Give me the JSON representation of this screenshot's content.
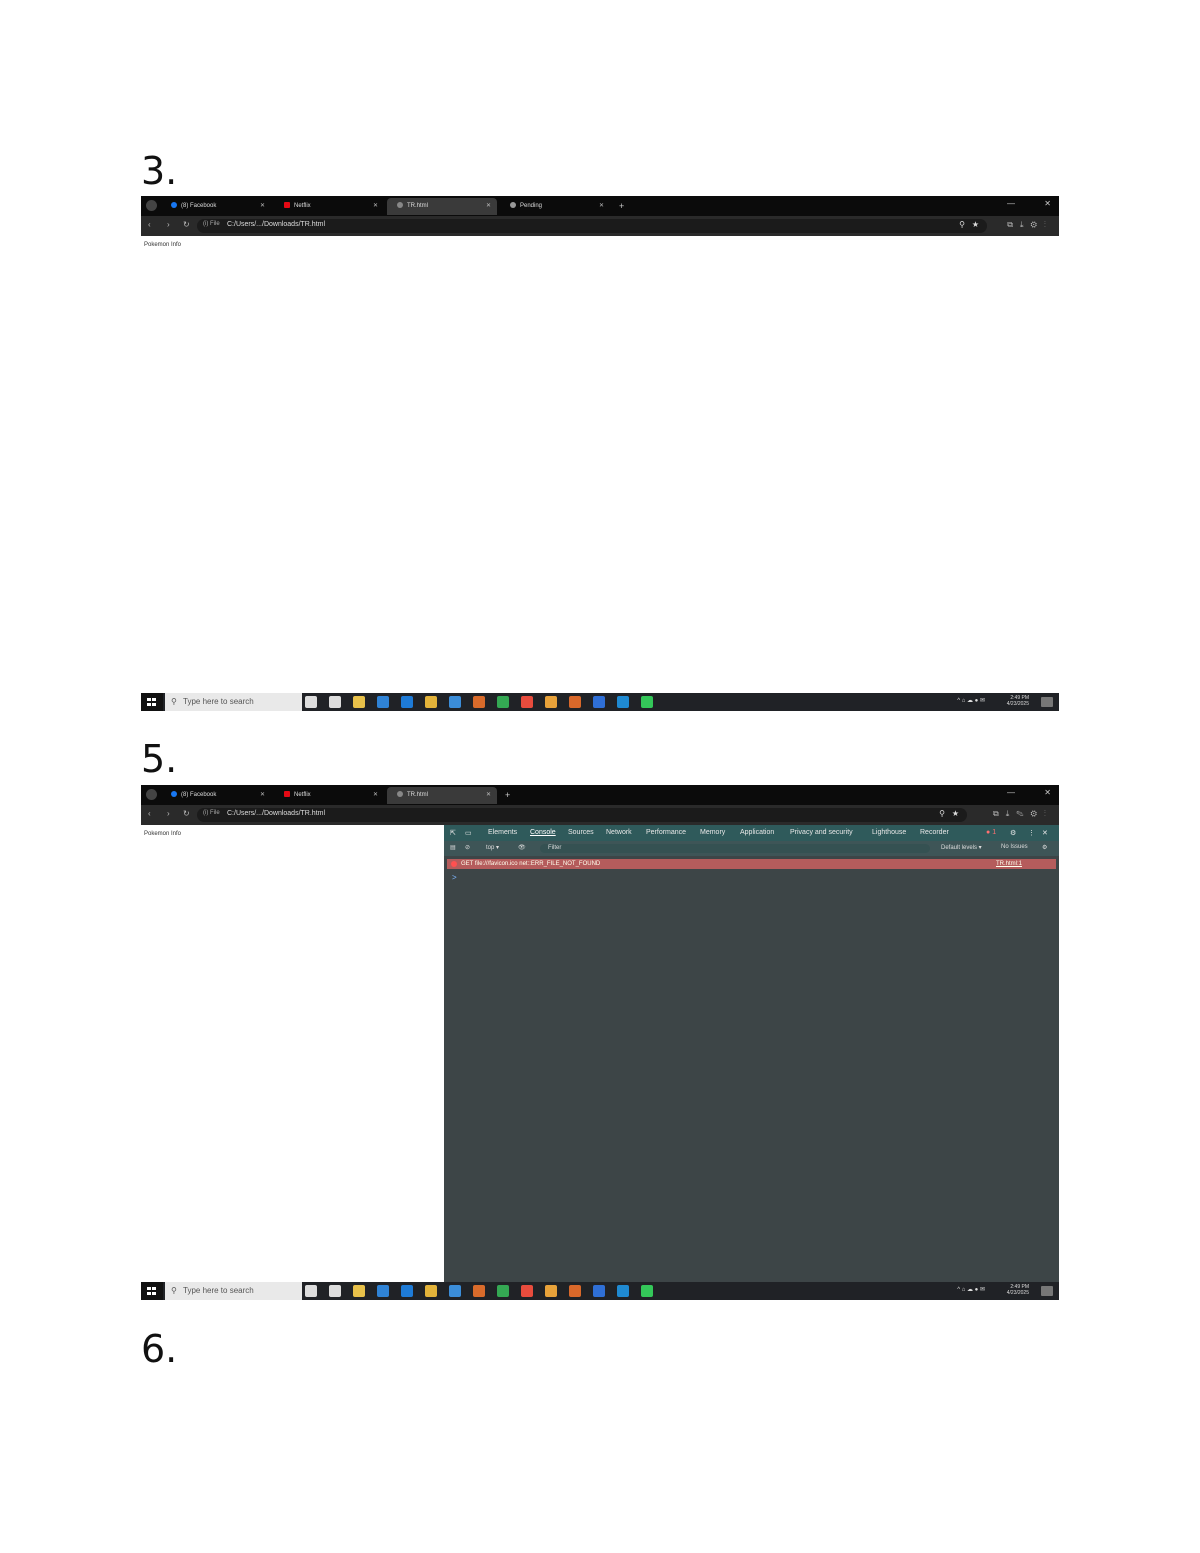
{
  "steps": [
    "3.",
    "5.",
    "6."
  ],
  "browser": {
    "tabs": [
      "(8) Facebook",
      "Netflix",
      "TR.html",
      "Pending"
    ],
    "new_tab": "+",
    "url": "C:/Users/.../Downloads/TR.html",
    "address_info": "(i) File",
    "page_text": "Pokemon Info",
    "window_controls": [
      "—",
      "□",
      "✕"
    ]
  },
  "taskbar": {
    "search_placeholder": "Type here to search",
    "clock_time": "2:49 PM",
    "clock_date": "4/23/2025",
    "app_icon_colors": [
      "#dddddd",
      "#dddddd",
      "#e8c14a",
      "#2f83d6",
      "#1e7bd7",
      "#e3b33a",
      "#3b8dd9",
      "#d96b2b",
      "#34a853",
      "#e84c3d",
      "#e8a23a",
      "#d9682a",
      "#2f6fd6",
      "#1f8ad2",
      "#34c759"
    ]
  },
  "devtools": {
    "tabs": [
      "Elements",
      "Console",
      "Sources",
      "Network",
      "Performance",
      "Memory",
      "Application",
      "Privacy and security",
      "Lighthouse",
      "Recorder"
    ],
    "active_tab": "Console",
    "context": "top ▾",
    "filter_placeholder": "Filter",
    "levels": "Default levels ▾",
    "issues": "No Issues",
    "error_count": "1",
    "error_text": "GET file:///favicon.ico net::ERR_FILE_NOT_FOUND",
    "error_source": "TR.html:1",
    "prompt": ">"
  }
}
